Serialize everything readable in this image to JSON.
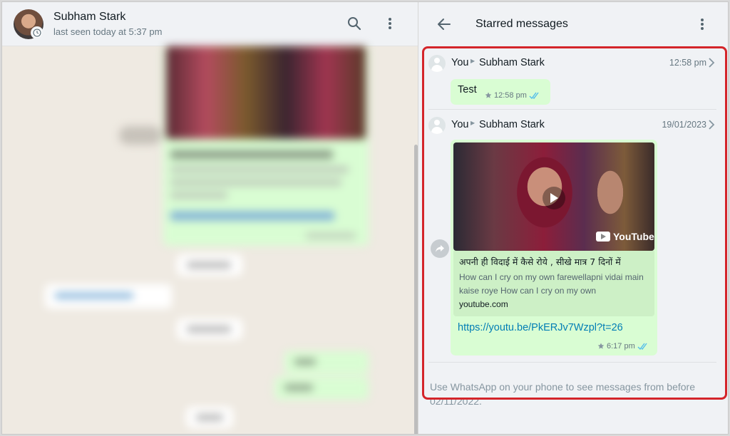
{
  "chat": {
    "contact_name": "Subham Stark",
    "last_seen": "last seen today at 5:37 pm"
  },
  "starred": {
    "title": "Starred messages",
    "messages": [
      {
        "from": "You",
        "to": "Subham Stark",
        "timestamp": "12:58 pm",
        "text": "Test",
        "time": "12:58 pm"
      },
      {
        "from": "You",
        "to": "Subham Stark",
        "timestamp": "19/01/2023",
        "link_preview": {
          "title": "अपनी ही विदाई में कैसे रोये , सीखे मात्र 7 दिनों में",
          "description": "How can I cry on my own farewellapni vidai main kaise roye How can I cry on my own",
          "domain": "youtube.com",
          "brand": "YouTube"
        },
        "url": "https://youtu.be/PkERJv7Wzpl?t=26",
        "time": "6:17 pm"
      }
    ],
    "footer_note": "Use WhatsApp on your phone to see messages from before 02/11/2022."
  },
  "colors": {
    "accent_highlight": "#d4252a",
    "bubble_outgoing": "#d9fdd3",
    "link": "#027eb5",
    "read_ticks": "#53bdeb"
  },
  "icons": [
    "search-icon",
    "menu-icon",
    "back-arrow-icon",
    "chevron-right-icon",
    "star-icon",
    "double-check-icon",
    "play-icon",
    "forward-icon",
    "youtube-icon"
  ]
}
